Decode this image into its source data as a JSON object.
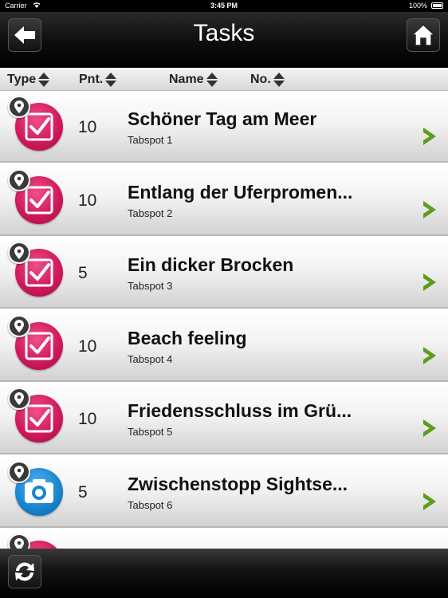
{
  "status_bar": {
    "carrier": "Carrier",
    "time": "3:45 PM",
    "battery": "100%"
  },
  "header": {
    "title": "Tasks"
  },
  "sort_columns": [
    {
      "label": "Type"
    },
    {
      "label": "Pnt."
    },
    {
      "label": "Name"
    },
    {
      "label": "No."
    }
  ],
  "tasks": [
    {
      "type": "check-icon",
      "points": "10",
      "name": "Schöner Tag am Meer",
      "subtitle": "Tabspot 1"
    },
    {
      "type": "check-icon",
      "points": "10",
      "name": "Entlang der Uferpromen...",
      "subtitle": "Tabspot 2"
    },
    {
      "type": "check-icon",
      "points": "5",
      "name": "Ein dicker Brocken",
      "subtitle": "Tabspot 3"
    },
    {
      "type": "check-icon",
      "points": "10",
      "name": "Beach feeling",
      "subtitle": "Tabspot 4"
    },
    {
      "type": "check-icon",
      "points": "10",
      "name": "Friedensschluss im Grü...",
      "subtitle": "Tabspot 5"
    },
    {
      "type": "camera-icon",
      "points": "5",
      "name": "Zwischenstopp Sightse...",
      "subtitle": "Tabspot 6"
    },
    {
      "type": "check-icon",
      "points": "",
      "name": "",
      "subtitle": ""
    }
  ],
  "colors": {
    "accent_chevron": "#5a9e1a",
    "check_icon": "#d01a5c",
    "camera_icon": "#1b86d0"
  }
}
